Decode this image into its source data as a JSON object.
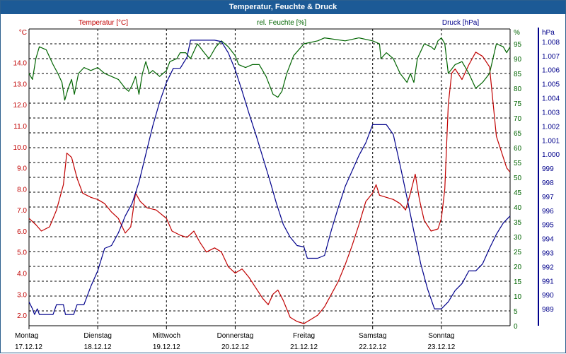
{
  "window": {
    "title": "Temperatur, Feuchte & Druck"
  },
  "chart_data": {
    "type": "line",
    "title": "Temperatur, Feuchte & Druck",
    "x_categories": [
      {
        "day": "Montag",
        "date": "17.12.12"
      },
      {
        "day": "Dienstag",
        "date": "18.12.12"
      },
      {
        "day": "Mittwoch",
        "date": "19.12.12"
      },
      {
        "day": "Donnerstag",
        "date": "20.12.12"
      },
      {
        "day": "Freitag",
        "date": "21.12.12"
      },
      {
        "day": "Samstag",
        "date": "22.12.12"
      },
      {
        "day": "Sonntag",
        "date": "23.12.12"
      }
    ],
    "x_range_days": [
      0,
      7
    ],
    "grid": true,
    "axes": {
      "temperature": {
        "label": "Temperatur [°C]",
        "unit": "°C",
        "side": "left",
        "ylim": [
          1.5,
          15.6
        ],
        "ticks": [
          "2.0",
          "3.0",
          "4.0",
          "5.0",
          "6.0",
          "7.0",
          "8.0",
          "9.0",
          "10.0",
          "11.0",
          "12.0",
          "13.0",
          "14.0"
        ],
        "color": "#c00000"
      },
      "humidity": {
        "label": "rel. Feuchte [%]",
        "unit": "%",
        "side": "right",
        "ylim": [
          0,
          100
        ],
        "ticks": [
          "0",
          "5",
          "10",
          "15",
          "20",
          "25",
          "30",
          "35",
          "40",
          "45",
          "50",
          "55",
          "60",
          "65",
          "70",
          "75",
          "80",
          "85",
          "90",
          "95",
          "%"
        ],
        "color": "#006400"
      },
      "pressure": {
        "label": "Druck [hPa]",
        "unit": "hPa",
        "side": "right-outer",
        "ylim": [
          987.8,
          1008.9
        ],
        "ticks": [
          "989",
          "990",
          "991",
          "992",
          "993",
          "994",
          "995",
          "996",
          "997",
          "998",
          "999",
          "1.000",
          "1.001",
          "1.002",
          "1.003",
          "1.004",
          "1.005",
          "1.006",
          "1.007",
          "1.008",
          "hPa"
        ],
        "color": "#00008b"
      }
    },
    "series": [
      {
        "name": "Temperatur [°C]",
        "axis": "temperature",
        "color": "#c00000",
        "points": [
          [
            0.0,
            6.6
          ],
          [
            0.1,
            6.3
          ],
          [
            0.18,
            6.0
          ],
          [
            0.3,
            6.2
          ],
          [
            0.4,
            7.0
          ],
          [
            0.5,
            8.2
          ],
          [
            0.55,
            9.7
          ],
          [
            0.62,
            9.5
          ],
          [
            0.7,
            8.5
          ],
          [
            0.78,
            7.8
          ],
          [
            0.9,
            7.6
          ],
          [
            1.0,
            7.5
          ],
          [
            1.1,
            7.3
          ],
          [
            1.2,
            6.9
          ],
          [
            1.3,
            6.6
          ],
          [
            1.4,
            5.9
          ],
          [
            1.48,
            6.2
          ],
          [
            1.55,
            7.8
          ],
          [
            1.62,
            7.4
          ],
          [
            1.72,
            7.1
          ],
          [
            1.85,
            7.0
          ],
          [
            2.0,
            6.6
          ],
          [
            2.08,
            6.0
          ],
          [
            2.2,
            5.8
          ],
          [
            2.3,
            5.7
          ],
          [
            2.4,
            6.0
          ],
          [
            2.48,
            5.5
          ],
          [
            2.58,
            5.0
          ],
          [
            2.7,
            5.2
          ],
          [
            2.8,
            5.0
          ],
          [
            2.9,
            4.3
          ],
          [
            3.0,
            4.0
          ],
          [
            3.1,
            4.2
          ],
          [
            3.2,
            3.8
          ],
          [
            3.3,
            3.3
          ],
          [
            3.4,
            2.8
          ],
          [
            3.48,
            2.5
          ],
          [
            3.55,
            3.0
          ],
          [
            3.62,
            3.2
          ],
          [
            3.7,
            2.7
          ],
          [
            3.8,
            1.9
          ],
          [
            3.9,
            1.7
          ],
          [
            4.0,
            1.6
          ],
          [
            4.1,
            1.8
          ],
          [
            4.2,
            2.0
          ],
          [
            4.3,
            2.4
          ],
          [
            4.4,
            3.0
          ],
          [
            4.5,
            3.6
          ],
          [
            4.6,
            4.4
          ],
          [
            4.7,
            5.3
          ],
          [
            4.8,
            6.3
          ],
          [
            4.9,
            7.4
          ],
          [
            5.0,
            7.8
          ],
          [
            5.05,
            8.2
          ],
          [
            5.1,
            7.7
          ],
          [
            5.2,
            7.6
          ],
          [
            5.3,
            7.5
          ],
          [
            5.4,
            7.3
          ],
          [
            5.48,
            7.0
          ],
          [
            5.55,
            7.8
          ],
          [
            5.62,
            8.7
          ],
          [
            5.68,
            7.5
          ],
          [
            5.75,
            6.5
          ],
          [
            5.85,
            6.0
          ],
          [
            5.95,
            6.1
          ],
          [
            6.0,
            6.6
          ],
          [
            6.05,
            8.0
          ],
          [
            6.1,
            12.0
          ],
          [
            6.15,
            13.5
          ],
          [
            6.2,
            13.7
          ],
          [
            6.3,
            13.2
          ],
          [
            6.4,
            13.9
          ],
          [
            6.5,
            14.5
          ],
          [
            6.6,
            14.3
          ],
          [
            6.7,
            13.8
          ],
          [
            6.8,
            10.5
          ],
          [
            6.9,
            9.5
          ],
          [
            6.95,
            9.0
          ],
          [
            7.0,
            8.8
          ]
        ]
      },
      {
        "name": "rel. Feuchte [%]",
        "axis": "humidity",
        "color": "#006400",
        "points": [
          [
            0.0,
            85
          ],
          [
            0.05,
            83
          ],
          [
            0.1,
            90
          ],
          [
            0.15,
            94
          ],
          [
            0.25,
            93
          ],
          [
            0.35,
            88
          ],
          [
            0.42,
            85
          ],
          [
            0.48,
            82
          ],
          [
            0.52,
            76
          ],
          [
            0.57,
            80
          ],
          [
            0.62,
            83
          ],
          [
            0.66,
            78
          ],
          [
            0.72,
            85
          ],
          [
            0.8,
            87
          ],
          [
            0.9,
            86
          ],
          [
            1.0,
            87
          ],
          [
            1.1,
            85
          ],
          [
            1.2,
            84
          ],
          [
            1.3,
            83
          ],
          [
            1.4,
            80
          ],
          [
            1.45,
            79
          ],
          [
            1.5,
            81
          ],
          [
            1.55,
            84
          ],
          [
            1.6,
            78
          ],
          [
            1.65,
            85
          ],
          [
            1.7,
            89
          ],
          [
            1.75,
            85
          ],
          [
            1.8,
            86
          ],
          [
            1.9,
            84
          ],
          [
            2.0,
            86
          ],
          [
            2.05,
            89
          ],
          [
            2.15,
            90
          ],
          [
            2.2,
            92
          ],
          [
            2.28,
            92
          ],
          [
            2.35,
            90
          ],
          [
            2.45,
            95
          ],
          [
            2.55,
            92
          ],
          [
            2.62,
            90
          ],
          [
            2.72,
            94
          ],
          [
            2.8,
            96
          ],
          [
            2.9,
            94
          ],
          [
            3.0,
            91
          ],
          [
            3.05,
            88
          ],
          [
            3.15,
            87
          ],
          [
            3.25,
            88
          ],
          [
            3.35,
            88
          ],
          [
            3.45,
            84
          ],
          [
            3.55,
            78
          ],
          [
            3.62,
            77
          ],
          [
            3.68,
            79
          ],
          [
            3.75,
            85
          ],
          [
            3.85,
            91
          ],
          [
            4.0,
            95
          ],
          [
            4.2,
            96
          ],
          [
            4.3,
            97
          ],
          [
            4.6,
            96
          ],
          [
            4.8,
            97
          ],
          [
            5.0,
            96
          ],
          [
            5.1,
            95
          ],
          [
            5.12,
            90
          ],
          [
            5.2,
            92
          ],
          [
            5.3,
            90
          ],
          [
            5.4,
            85
          ],
          [
            5.5,
            82
          ],
          [
            5.55,
            85
          ],
          [
            5.6,
            82
          ],
          [
            5.65,
            90
          ],
          [
            5.75,
            95
          ],
          [
            5.85,
            94
          ],
          [
            5.9,
            93
          ],
          [
            5.95,
            96
          ],
          [
            6.0,
            97
          ],
          [
            6.05,
            95
          ],
          [
            6.1,
            85
          ],
          [
            6.2,
            88
          ],
          [
            6.3,
            89
          ],
          [
            6.4,
            85
          ],
          [
            6.5,
            80
          ],
          [
            6.6,
            82
          ],
          [
            6.7,
            85
          ],
          [
            6.8,
            95
          ],
          [
            6.9,
            94
          ],
          [
            6.95,
            92
          ],
          [
            7.0,
            94
          ]
        ]
      },
      {
        "name": "Druck [hPa]",
        "axis": "pressure",
        "color": "#00008b",
        "points": [
          [
            0.0,
            989.5
          ],
          [
            0.05,
            989.0
          ],
          [
            0.08,
            988.6
          ],
          [
            0.12,
            989.0
          ],
          [
            0.15,
            988.6
          ],
          [
            0.35,
            988.6
          ],
          [
            0.4,
            989.3
          ],
          [
            0.5,
            989.3
          ],
          [
            0.53,
            988.6
          ],
          [
            0.65,
            988.6
          ],
          [
            0.7,
            989.3
          ],
          [
            0.8,
            989.3
          ],
          [
            0.9,
            990.6
          ],
          [
            1.0,
            991.7
          ],
          [
            1.05,
            992.5
          ],
          [
            1.1,
            993.3
          ],
          [
            1.2,
            993.5
          ],
          [
            1.3,
            994.4
          ],
          [
            1.4,
            995.6
          ],
          [
            1.5,
            996.5
          ],
          [
            1.6,
            998.0
          ],
          [
            1.7,
            1000.0
          ],
          [
            1.8,
            1002.0
          ],
          [
            1.9,
            1003.7
          ],
          [
            2.0,
            1005.1
          ],
          [
            2.1,
            1006.1
          ],
          [
            2.2,
            1006.1
          ],
          [
            2.3,
            1006.9
          ],
          [
            2.35,
            1008.1
          ],
          [
            2.5,
            1008.1
          ],
          [
            2.7,
            1008.1
          ],
          [
            2.8,
            1008.0
          ],
          [
            2.9,
            1007.2
          ],
          [
            3.0,
            1006.0
          ],
          [
            3.1,
            1004.5
          ],
          [
            3.2,
            1002.9
          ],
          [
            3.3,
            1001.4
          ],
          [
            3.4,
            999.8
          ],
          [
            3.5,
            998.2
          ],
          [
            3.6,
            996.5
          ],
          [
            3.7,
            995.0
          ],
          [
            3.8,
            994.1
          ],
          [
            3.9,
            993.5
          ],
          [
            4.0,
            993.4
          ],
          [
            4.05,
            992.6
          ],
          [
            4.1,
            992.6
          ],
          [
            4.2,
            992.6
          ],
          [
            4.3,
            992.8
          ],
          [
            4.4,
            994.6
          ],
          [
            4.5,
            996.2
          ],
          [
            4.6,
            997.7
          ],
          [
            4.7,
            998.8
          ],
          [
            4.8,
            999.9
          ],
          [
            4.9,
            1000.8
          ],
          [
            5.0,
            1002.1
          ],
          [
            5.1,
            1002.1
          ],
          [
            5.2,
            1002.1
          ],
          [
            5.3,
            1001.4
          ],
          [
            5.4,
            999.2
          ],
          [
            5.5,
            996.9
          ],
          [
            5.6,
            994.5
          ],
          [
            5.7,
            992.2
          ],
          [
            5.8,
            990.4
          ],
          [
            5.9,
            989.0
          ],
          [
            6.0,
            989.0
          ],
          [
            6.1,
            989.5
          ],
          [
            6.2,
            990.3
          ],
          [
            6.3,
            990.8
          ],
          [
            6.4,
            991.7
          ],
          [
            6.5,
            991.7
          ],
          [
            6.6,
            992.2
          ],
          [
            6.7,
            993.3
          ],
          [
            6.8,
            994.3
          ],
          [
            6.9,
            995.1
          ],
          [
            7.0,
            995.6
          ]
        ]
      }
    ]
  }
}
